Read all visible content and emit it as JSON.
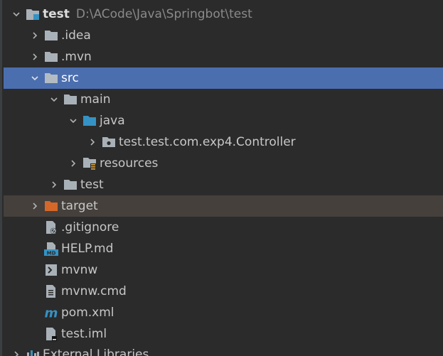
{
  "project": {
    "name": "test",
    "path": "D:\\ACode\\Java\\Springbot\\test"
  },
  "nodes": {
    "idea": ".idea",
    "mvn": ".mvn",
    "src": "src",
    "main": "main",
    "java": "java",
    "controller_pkg": "test.test.com.exp4.Controller",
    "resources": "resources",
    "test_dir": "test",
    "target": "target",
    "gitignore": ".gitignore",
    "help_md": "HELP.md",
    "mvnw": "mvnw",
    "mvnw_cmd": "mvnw.cmd",
    "pom": "pom.xml",
    "test_iml": "test.iml",
    "external": "External Libraries"
  },
  "icons": {
    "module": "module-folder-icon",
    "folder": "folder-icon",
    "source_root": "source-root-folder-icon",
    "package": "package-icon",
    "resources": "resources-folder-icon",
    "excluded": "excluded-folder-icon",
    "ignore_file": "ignore-file-icon",
    "markdown": "markdown-file-icon",
    "shell": "shell-script-icon",
    "text_file": "text-file-icon",
    "maven": "maven-icon",
    "iml": "iml-file-icon",
    "library": "library-icon"
  },
  "colors": {
    "background": "#2b2b2b",
    "selection": "#4b6eaf",
    "excluded_row": "#45403c",
    "folder": "#a9b1b8",
    "source_folder": "#3592c4",
    "excluded_folder": "#d4682a"
  }
}
